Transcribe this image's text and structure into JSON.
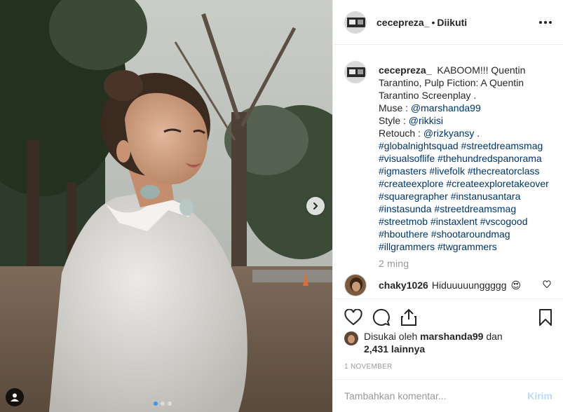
{
  "header": {
    "username": "cecepreza_",
    "separator": "•",
    "follow_status": "Diikuti",
    "more_icon": "more-horizontal-icon"
  },
  "caption": {
    "username": "cecepreza_",
    "text_line1": "KABOOM!!! Quentin",
    "text_line2": "Tarantino, Pulp Fiction: A Quentin",
    "text_line3": "Tarantino Screenplay .",
    "muse_label": "Muse :",
    "muse_handle": "@marshanda99",
    "style_label": "Style :",
    "style_handle": "@rikkisi",
    "retouch_label": "Retouch :",
    "retouch_handle": "@rizkyansy",
    "retouch_suffix": ".",
    "hashtag_lines": [
      [
        "#globalnightsquad",
        "#streetdreamsmag"
      ],
      [
        "#visualsoflife",
        "#thehundredspanorama"
      ],
      [
        "#igmasters",
        "#livefolk",
        "#thecreatorclass"
      ],
      [
        "#createexplore",
        "#createexploretakeover"
      ],
      [
        "#squaregrapher",
        "#instanusantara"
      ],
      [
        "#instasunda",
        "#streetdreamsmag"
      ],
      [
        "#streetmob",
        "#instaxlent",
        "#vscogood"
      ],
      [
        "#hbouthere",
        "#shootaroundmag"
      ],
      [
        "#illgrammers",
        "#twgrammers"
      ]
    ],
    "time": "2 ming"
  },
  "comment": {
    "username": "chaky1026",
    "text": "Hiduuuuunggggg",
    "emoji": "😍"
  },
  "likes": {
    "prefix": "Disukai oleh",
    "user": "marshanda99",
    "conj": "dan",
    "count": "2,431 lainnya"
  },
  "date": "1 NOVEMBER",
  "composer": {
    "placeholder": "Tambahkan komentar...",
    "post_label": "Kirim"
  },
  "carousel": {
    "slides": 3,
    "active_index": 0
  },
  "colors": {
    "link": "#003569",
    "accent": "#3897f0",
    "muted": "#999999",
    "text": "#262626"
  }
}
